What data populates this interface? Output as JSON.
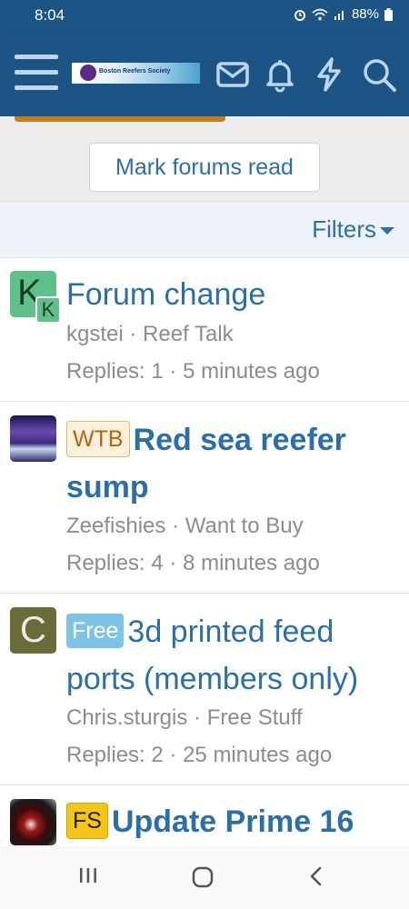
{
  "status": {
    "time": "8:04",
    "battery": "88%",
    "icons": [
      "alarm-icon",
      "wifi-icon",
      "signal-icon",
      "battery-icon"
    ]
  },
  "header": {
    "logo_text": "Boston Reefers Society",
    "icons": [
      "menu-icon",
      "mail-icon",
      "bell-icon",
      "lightning-icon",
      "search-icon"
    ],
    "color": "#1b5485"
  },
  "actions": {
    "mark_forums_read": "Mark forums read",
    "filters": "Filters"
  },
  "threads": [
    {
      "avatar_letter": "K",
      "avatar_badge": "K",
      "avatar_color": "#5fc08a",
      "prefix": "",
      "title": "Forum change",
      "author": "kgstei",
      "forum": "Reef Talk",
      "sep": "·",
      "replies": "Replies: 1",
      "time": "5 minutes ago"
    },
    {
      "avatar_letter": "",
      "avatar_color": "#3b2a7a",
      "prefix": "WTB",
      "prefix_color": "#fdf1dc",
      "title_line1": "Red sea reefer",
      "title_line2": "sump",
      "author": "Zeefishies",
      "forum": "Want to Buy",
      "sep": "·",
      "replies": "Replies: 4",
      "time": "8 minutes ago"
    },
    {
      "avatar_letter": "C",
      "avatar_color": "#6b6b3a",
      "prefix": "Free",
      "prefix_color": "#7cc3e6",
      "title_line1": "3d printed feed",
      "title_line2": "ports (members only)",
      "author": "Chris.sturgis",
      "forum": "Free Stuff",
      "sep": "·",
      "replies": "Replies: 2",
      "time": "25 minutes ago"
    },
    {
      "avatar_letter": "",
      "avatar_color": "#5a1a1a",
      "prefix": "FS",
      "prefix_color": "#f5c518",
      "title": "Update Prime 16"
    }
  ],
  "nav": {
    "icons": [
      "recents-icon",
      "home-icon",
      "back-icon"
    ]
  }
}
